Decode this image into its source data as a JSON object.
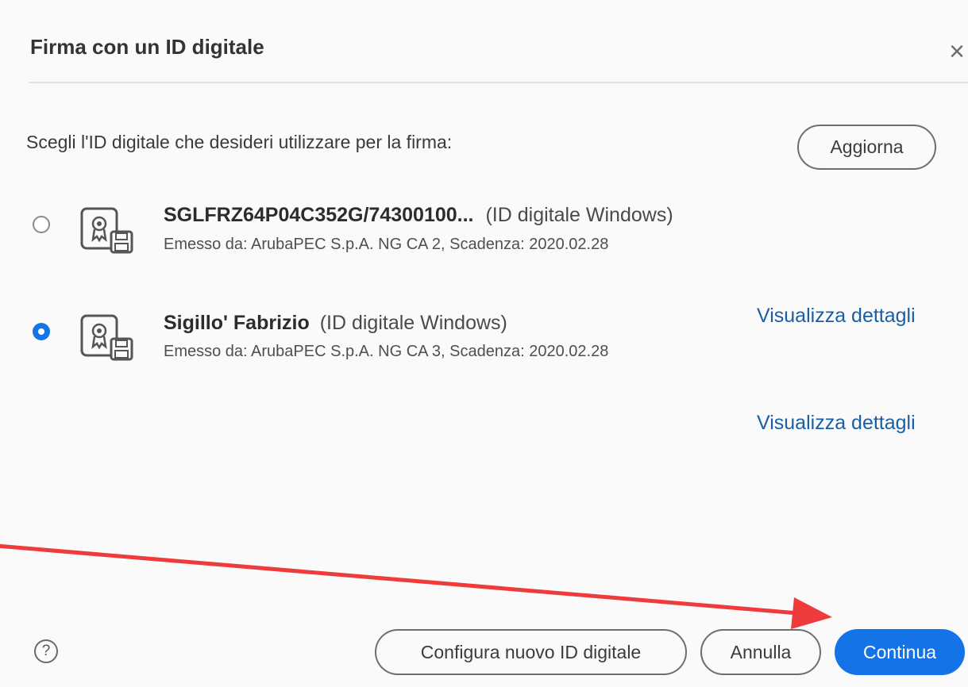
{
  "dialog": {
    "title": "Firma con un ID digitale",
    "close_label": "×"
  },
  "prompt": "Scegli l'ID digitale che desideri utilizzare per la firma:",
  "refresh_label": "Aggiorna",
  "ids": [
    {
      "name": "SGLFRZ64P04C352G/74300100...",
      "type": "(ID digitale Windows)",
      "issuer": "Emesso da: ArubaPEC S.p.A. NG CA 2, Scadenza: 2020.02.28",
      "selected": false,
      "icon": "certificate-icon"
    },
    {
      "name": "Sigillo' Fabrizio",
      "type": "(ID digitale Windows)",
      "issuer": "Emesso da: ArubaPEC S.p.A. NG CA 3, Scadenza: 2020.02.28",
      "selected": true,
      "icon": "certificate-icon"
    }
  ],
  "details_links": [
    "Visualizza dettagli",
    "Visualizza dettagli"
  ],
  "footer": {
    "help_label": "?",
    "configure_label": "Configura nuovo ID digitale",
    "cancel_label": "Annulla",
    "continue_label": "Continua"
  },
  "colors": {
    "accent": "#1473e6",
    "link": "#1a5fa6",
    "annotation_arrow": "#ef3b3b"
  }
}
